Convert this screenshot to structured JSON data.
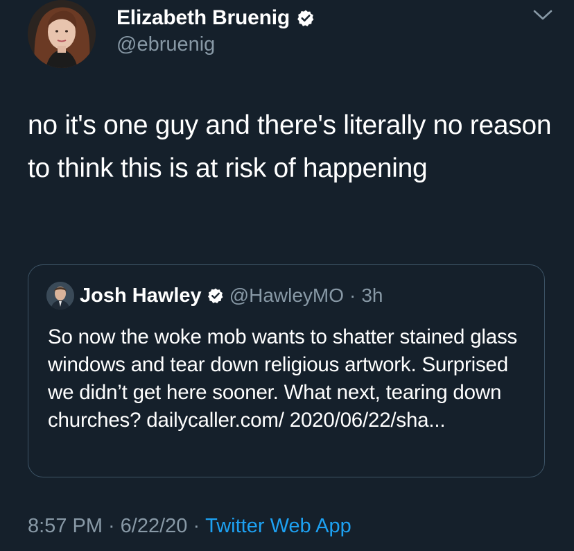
{
  "tweet": {
    "author": {
      "display_name": "Elizabeth Bruenig",
      "handle": "@ebruenig",
      "verified": true
    },
    "text": "no it's one guy and there's literally no reason to think this is at risk of happening",
    "quoted_tweet": {
      "author": {
        "display_name": "Josh Hawley",
        "handle": "@HawleyMO",
        "verified": true
      },
      "separator": "·",
      "time": "3h",
      "text": "So now the woke mob wants to shatter stained glass windows and tear down religious artwork. Surprised we didn’t get here sooner. What next, tearing down churches? dailycaller.com/ 2020/06/22/sha..."
    },
    "footer": {
      "time": "8:57 PM",
      "separator_1": "·",
      "date": "6/22/20",
      "separator_2": "·",
      "source": "Twitter Web App"
    }
  },
  "icons": {
    "verified": "verified-badge-icon",
    "menu": "chevron-down-icon"
  },
  "colors": {
    "background": "#15202b",
    "secondary_text": "#8899a6",
    "link": "#1da1f2",
    "border": "#3d5466"
  }
}
